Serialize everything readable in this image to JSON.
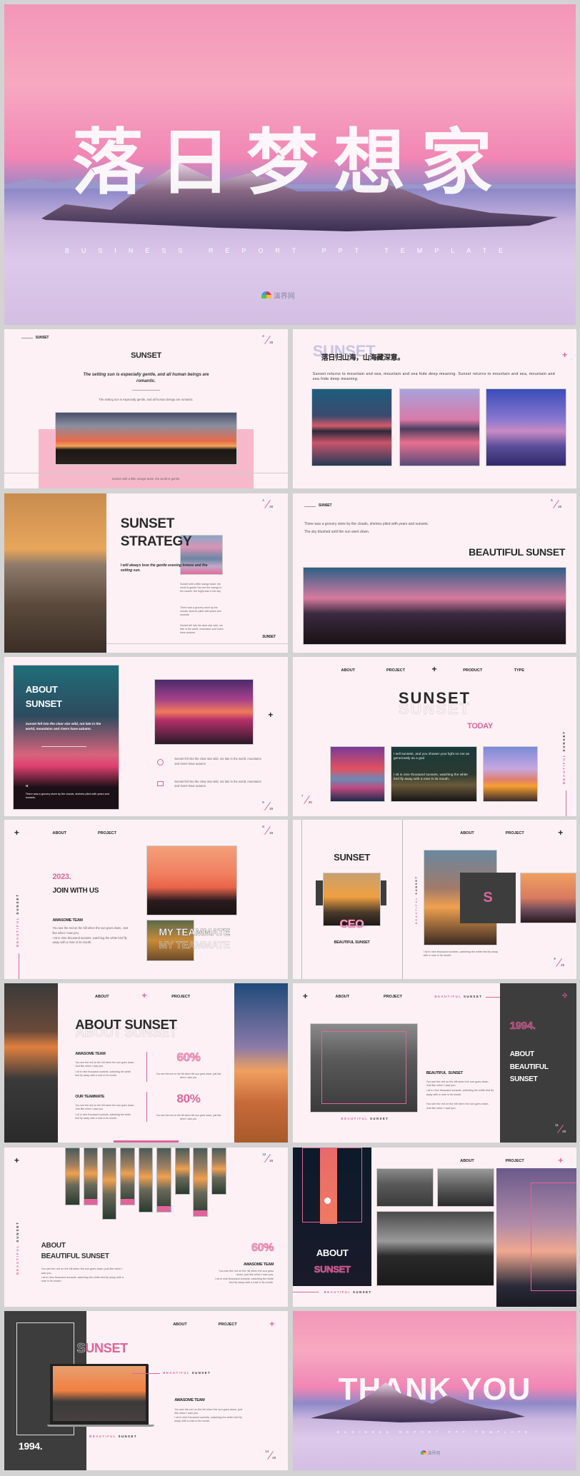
{
  "hero": {
    "title": "落日梦想家",
    "subtitle": "BUSINESS REPORT PPT TEMPLATE",
    "watermark": "演界网"
  },
  "s2": {
    "tag": "SUNSET",
    "page": "2",
    "total": "20",
    "title": "SUNSET",
    "quote": "The setting sun is especially gentle, and all human beings are romantic.",
    "small": "The setting sun is especially gentle, and all human beings are romantic.",
    "caption": "Sunset with a little orange taste, the world is gentle."
  },
  "s3": {
    "ghost": "SUNSET",
    "title": "落日归山海，山海藏深意。",
    "body": "Sunset returns to mountain and sea, mountain and sea hide deep meaning. Sunset returns to mountain and sea, mountain and sea hide deep meaning."
  },
  "s4": {
    "page": "4",
    "total": "20",
    "title1": "SUNSET",
    "title2": "STRATEGY",
    "quote": "I will always love the gentle evening breeze and the setting sun.",
    "p1": "Sunset with a little orange taste, the world is gentle.You are the orange in the sunset, the bright star in the sky.",
    "p2": "There was a grocery store by the clouds, shelves piled with years and sunsets.",
    "p3": "Sunset fell into the clear star wild, not late in the world, mountains and rivers have autumn.",
    "footer": "SUNSET"
  },
  "s5": {
    "tag": "SUNSET",
    "page": "5",
    "total": "20",
    "line1": "There was a grocery store by the clouds, shelves piled with years and sunsets.",
    "line2": "The sky blushed until the sun went down.",
    "title": "BEAUTIFUL SUNSET"
  },
  "s6": {
    "title1": "ABOUT",
    "title2": "SUNSET",
    "italic": "Sunset fell into the clear star wild, not late in the world, mountains and rivers have autumn.",
    "quote_mark": "“",
    "quote": "There was a grocery store by the clouds, shelves piled with years and sunsets.",
    "item1": "Sunset fell into the clear star wild, not late in the world, mountains and rivers have autumn.",
    "item2": "Sunset fell into the clear star wild, not late in the world, mountains and rivers have autumn.",
    "page": "6",
    "total": "20"
  },
  "s7": {
    "nav": [
      "ABOUT",
      "PROJECT",
      "PRODUCT",
      "TYPE"
    ],
    "title": "SUNSET",
    "today": "TODAY",
    "overlay1": "I sell sunsets, and you shower your light on me as generously as a god",
    "overlay2": "I sit in nine thousand sunsets, watching the white bird fly away with a rose in its mouth.",
    "side1": "BEAUTIFUL",
    "side2": "SUNSET",
    "page": "7",
    "total": "20"
  },
  "s8": {
    "nav": [
      "ABOUT",
      "PROJECT"
    ],
    "page": "8",
    "total": "20",
    "side1": "BEAUTIFUL",
    "side2": "SUNSET",
    "year": "2023.",
    "join": "JOIN WITH US",
    "team": "AWASOME TEAM",
    "text1": "You see the red on the hill when the sun goes down, Just like when I saw you.",
    "text2": "I sit in nine thousand sunsets, watching the white bird fly away with a rose in its mouth.",
    "teammate": "MY TEAMMATE"
  },
  "s9": {
    "title": "SUNSET",
    "ceo": "CEO",
    "subtitle": "BEAUTIFUL SUNSET",
    "nav": [
      "ABOUT",
      "PROJECT"
    ],
    "side1": "BEAUTIFUL",
    "side2": "SUNSET",
    "letter": "S",
    "text": "I sit in nine thousand sunsets, watching the white bird fly away with a rose in its mouth.",
    "page": "9",
    "total": "20"
  },
  "s10": {
    "nav": [
      "ABOUT",
      "PROJECT"
    ],
    "title": "ABOUT SUNSET",
    "team1": "AWASOME TEAM",
    "team2": "OUR TEAMMATE",
    "text1": "You see the red on the hill when the sun goes down, Just like when I saw you.",
    "text2": "I sit in nine thousand sunsets, watching the white bird fly away with a rose in its mouth.",
    "stat1": "60%",
    "stat2": "80%",
    "stat_text": "You see the red on the hill when the sun goes down, just like when I saw you."
  },
  "s11": {
    "nav": [
      "ABOUT",
      "PROJECT"
    ],
    "accent1": "BEAUTIFUL",
    "accent2": "SUNSET",
    "year": "1994.",
    "panel": [
      "ABOUT",
      "BEAUTIFUL",
      "SUNSET"
    ],
    "heading": "BEAUTIFUL  SUNSET",
    "text1": "You see the red on the hill when the sun goes down, Just like when I saw you.",
    "text2": "I sit in nine thousand sunsets, watching the white bird fly away with a rose in its mouth.",
    "text3": "You see the red on the hill when the sun goes down, Just like when I saw you.",
    "page": "11",
    "total": "20"
  },
  "s12": {
    "page": "12",
    "total": "20",
    "side1": "BEAUTIFUL",
    "side2": "SUNSET",
    "title1": "ABOUT",
    "title2": "BEAUTIFUL SUNSET",
    "text1": "You see the red on the hill when the sun goes down, just like when I saw you.",
    "text2": "I sit in nine thousand sunsets, watching the white bird fly away with a rose in its mouth.",
    "stat": "60%",
    "team": "AWASOME TEAM"
  },
  "s13": {
    "title1": "ABOUT",
    "title2": "SUNSET",
    "nav": [
      "ABOUT",
      "PROJECT"
    ],
    "accent1": "BEAUTIFUL",
    "accent2": "SUNSET"
  },
  "s14": {
    "year": "1994.",
    "nav": [
      "ABOUT",
      "PROJECT"
    ],
    "title_first": "S",
    "title_rest": "UNSET",
    "accent1": "BEAUTIFUL",
    "accent2": "SUNSET",
    "team": "AWASOME TEAM",
    "text1": "You see the red on the hill when the sun goes down, just like when I saw you.",
    "text2": "I sit in nine thousand sunsets, watching the white bird fly away with a rose in its mouth.",
    "page": "14",
    "total": "20"
  },
  "s15": {
    "title": "THANK YOU",
    "subtitle": "BUSINESS REPORT PPT TEMPLATE",
    "watermark": "演界网"
  },
  "colors": {
    "accent": "#e0649a",
    "dark": "#3d3d3d",
    "slide_bg": "#fdf1f5"
  }
}
